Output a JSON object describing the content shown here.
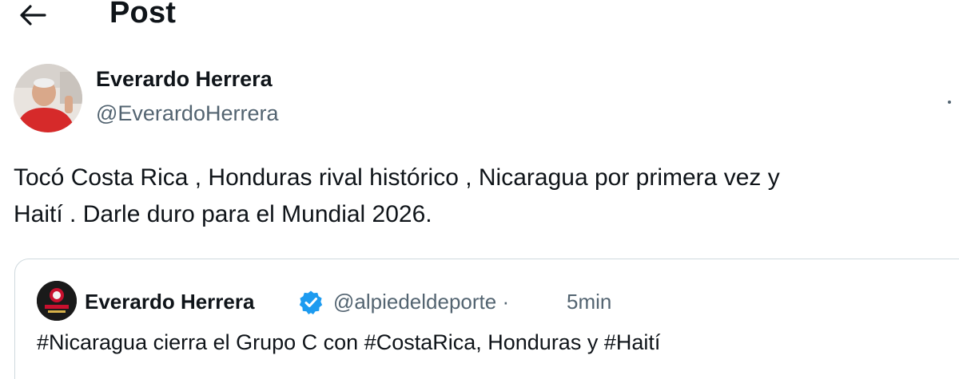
{
  "header": {
    "back_icon": "arrow-left-icon",
    "title": "Post"
  },
  "post": {
    "author": {
      "name": "Everardo Herrera",
      "handle": "@EverardoHerrera"
    },
    "more_icon": "more-options-icon",
    "text_lines": [
      "Tocó Costa Rica , Honduras rival histórico , Nicaragua por primera vez y",
      "Haití . Darle duro para el Mundial 2026."
    ]
  },
  "quote": {
    "author": {
      "name": "Everardo Herrera",
      "handle": "@alpiedeldeporte",
      "separator": "·",
      "time": "5min",
      "verified_icon": "verified-badge-icon"
    },
    "text": "#Nicaragua cierra el Grupo C con #CostaRica, Honduras y #Haití"
  },
  "colors": {
    "text_primary": "#0f1419",
    "text_secondary": "#536471",
    "border": "#cfd9de",
    "verified_blue": "#1d9bf0"
  }
}
